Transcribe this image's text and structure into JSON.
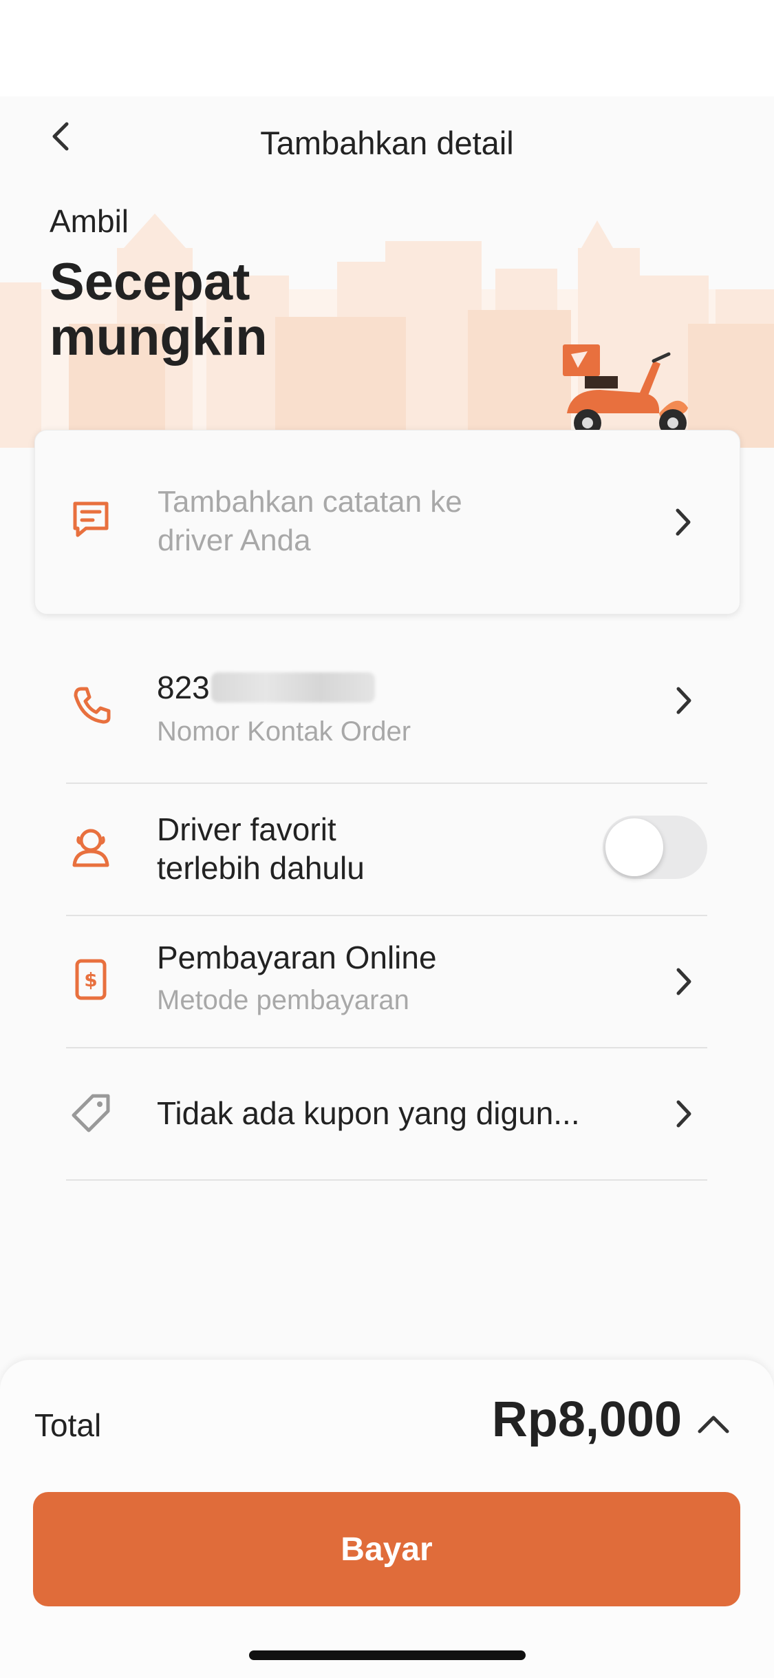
{
  "header": {
    "title": "Tambahkan detail"
  },
  "hero": {
    "eyebrow": "Ambil",
    "headline": "Secepat mungkin"
  },
  "note": {
    "placeholder": "Tambahkan catatan ke driver Anda"
  },
  "contact": {
    "phone_prefix": "823",
    "label": "Nomor Kontak Order"
  },
  "favorite_driver": {
    "label_line1": "Driver favorit",
    "label_line2": "terlebih dahulu",
    "enabled": false
  },
  "payment": {
    "title": "Pembayaran Online",
    "subtitle": "Metode pembayaran"
  },
  "coupon": {
    "title": "Tidak ada kupon yang digun..."
  },
  "summary": {
    "total_label": "Total",
    "total_amount": "Rp8,000",
    "pay_label": "Bayar"
  },
  "colors": {
    "accent": "#e06c3a",
    "icon": "#e8703e",
    "text": "#222222",
    "muted": "#a8a8a8"
  },
  "icons": [
    "back-arrow-icon",
    "scooter-illustration",
    "note-icon",
    "phone-icon",
    "driver-icon",
    "payment-icon",
    "coupon-tag-icon",
    "chevron-right-icon",
    "chevron-up-icon"
  ]
}
